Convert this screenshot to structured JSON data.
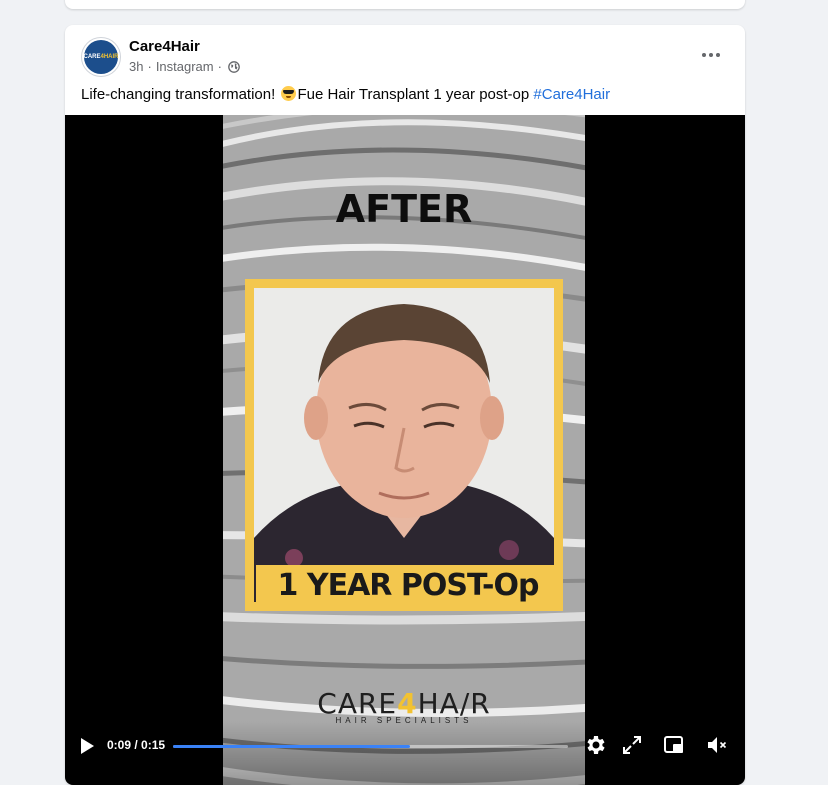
{
  "post": {
    "page_name": "Care4Hair",
    "time": "3h",
    "separator": "·",
    "source": "Instagram",
    "text_before": "Life-changing transformation! ",
    "text_after": "Fue Hair Transplant 1 year post-op ",
    "hashtag": "#Care4Hair",
    "avatar_text_a": "CARE",
    "avatar_text_b": "4HAIR"
  },
  "video": {
    "heading": "AFTER",
    "caption": "1 YEAR POST-Op",
    "logo_a": "CARE",
    "logo_b": "4",
    "logo_c": "HA/R",
    "logo_sub": "HAIR SPECIALISTS",
    "current_time": "0:09",
    "time_sep": " / ",
    "duration": "0:15",
    "progress": 0.6
  },
  "colors": {
    "accent": "#3a82f7",
    "hashtag": "#216fdb",
    "brand_yellow": "#f3c74e",
    "brand_blue": "#1c4e8c"
  },
  "icons": {
    "play": "play-icon",
    "settings": "gear-icon",
    "fullscreen": "expand-icon",
    "pip": "picture-in-picture-icon",
    "mute": "speaker-muted-icon",
    "more": "more-dots-icon",
    "privacy": "globe-icon"
  }
}
